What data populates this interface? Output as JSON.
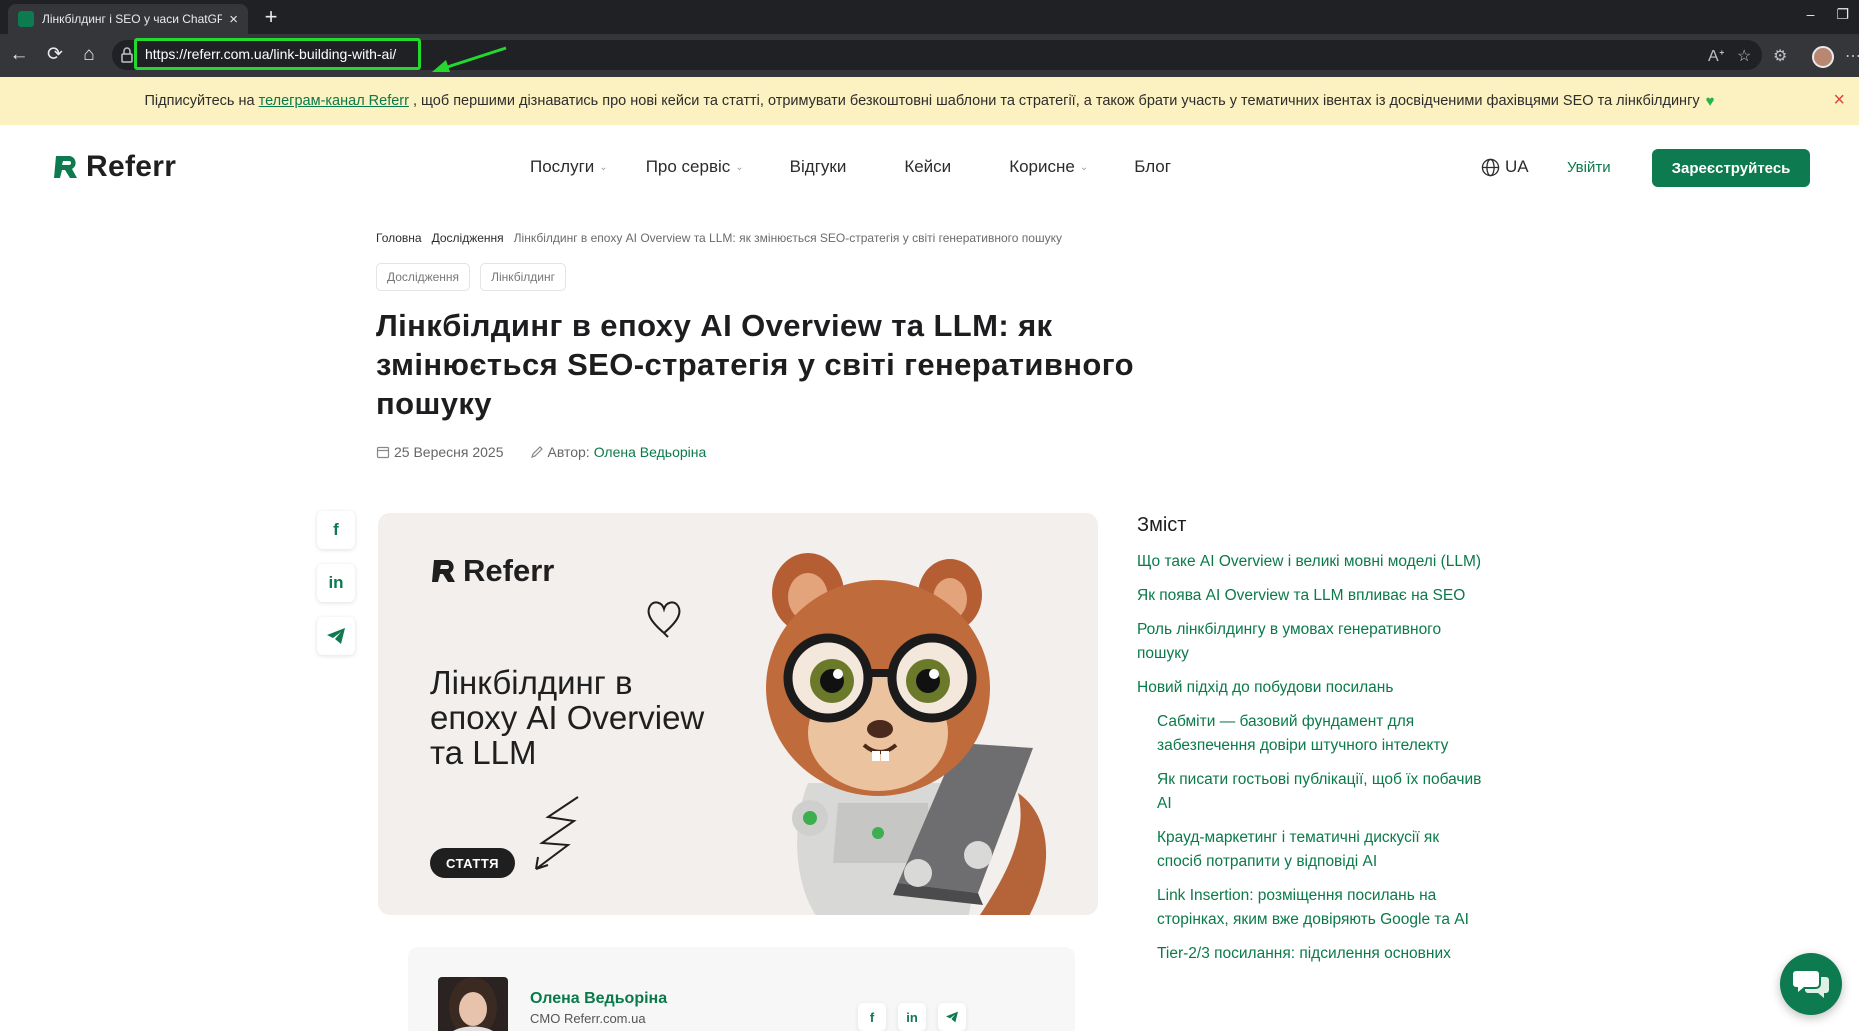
{
  "browser": {
    "tab_title": "Лінкбілдинг і SEO у часи ChatGPT",
    "url": "https://referr.com.ua/link-building-with-ai/"
  },
  "announcement": {
    "text_before": "Підписуйтесь на",
    "link_text": "телеграм-канал Referr",
    "text_after": ", щоб першими дізнаватись про нові кейси та статті, отримувати безкоштовні шаблони та стратегії, а також брати участь у тематичних івентах із досвідченими фахівцями SEO та лінкбілдингу",
    "close_icon": "×"
  },
  "header": {
    "logo_text": "Referr",
    "nav": [
      {
        "label": "Послуги",
        "has_menu": true
      },
      {
        "label": "Про сервіс",
        "has_menu": true
      },
      {
        "label": "Відгуки",
        "has_menu": false
      },
      {
        "label": "Кейси",
        "has_menu": false
      },
      {
        "label": "Корисне",
        "has_menu": true
      },
      {
        "label": "Блог",
        "has_menu": false
      }
    ],
    "language": "UA",
    "login": "Увійти",
    "register": "Зареєструйтесь"
  },
  "breadcrumbs": [
    "Головна",
    "Дослідження",
    "Лінкбілдинг в епоху AI Overview та LLM: як змінюється SEO-стратегія у світі генеративного пошуку"
  ],
  "tags": [
    "Дослідження",
    "Лінкбілдинг"
  ],
  "article": {
    "title": "Лінкбілдинг в епоху AI Overview та LLM: як змінюється SEO-стратегія у світі генеративного пошуку",
    "date": "25 Вересня 2025",
    "author_label": "Автор:",
    "author": "Олена Ведьоріна"
  },
  "hero": {
    "logo_text": "Referr",
    "title": "Лінкбілдинг в епоху AI Overview та LLM",
    "badge": "СТАТТЯ"
  },
  "author_card": {
    "name": "Олена Ведьоріна",
    "role": "CMO Referr.com.ua"
  },
  "share_icons": [
    "facebook-icon",
    "linkedin-icon",
    "telegram-icon"
  ],
  "toc": {
    "title": "Зміст",
    "items": [
      {
        "label": "Що таке AI Overview і великі мовні моделі (LLM)",
        "level": 1
      },
      {
        "label": "Як поява AI Overview та LLM впливає на SEO",
        "level": 1
      },
      {
        "label": "Роль лінкбілдингу в умовах генеративного пошуку",
        "level": 1
      },
      {
        "label": "Новий підхід до побудови посилань",
        "level": 1
      },
      {
        "label": "Сабміти — базовий фундамент для забезпечення довіри штучного інтелекту",
        "level": 2
      },
      {
        "label": "Як писати гостьові публікації, щоб їх побачив AI",
        "level": 2
      },
      {
        "label": "Крауд-маркетинг і тематичні дискусії як спосіб потрапити у відповіді AI",
        "level": 2
      },
      {
        "label": "Link Insertion: розміщення посилань на сторінках, яким вже довіряють Google та AI",
        "level": 2
      },
      {
        "label": "Tier-2/3 посилання: підсилення основних",
        "level": 2
      }
    ]
  },
  "colors": {
    "brand_green": "#0d7a4f",
    "announcement_bg": "#fcf1c0",
    "annotation_green": "#24d82e"
  }
}
